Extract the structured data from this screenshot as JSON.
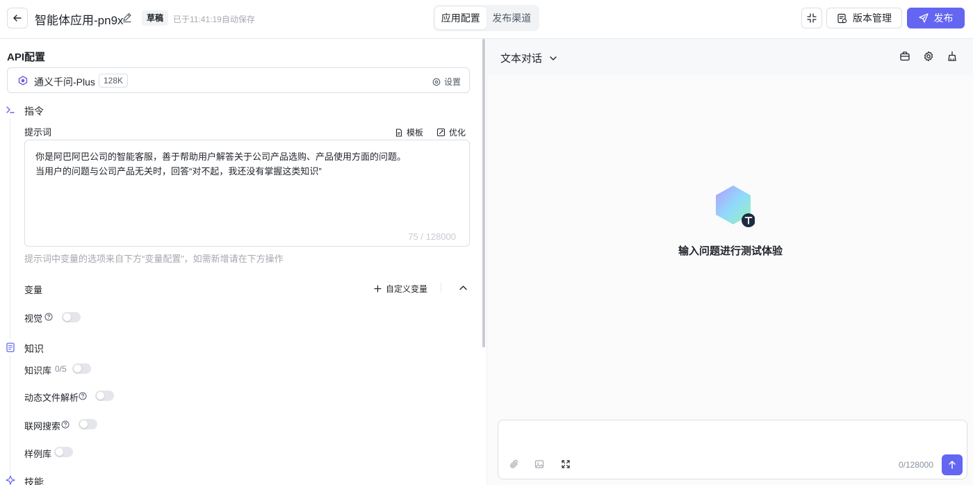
{
  "header": {
    "app_title": "智能体应用-pn9x",
    "status_badge": "草稿",
    "autosave_text": "已于11:41:19自动保存",
    "tabs": [
      {
        "label": "应用配置",
        "active": true
      },
      {
        "label": "发布渠道",
        "active": false
      }
    ],
    "version_label": "版本管理",
    "publish_label": "发布"
  },
  "left": {
    "api_title": "API配置",
    "model_name": "通义千问-Plus",
    "model_context": "128K",
    "model_settings_label": "设置",
    "instruction": {
      "title": "指令",
      "prompt_label": "提示词",
      "template_label": "模板",
      "optimize_label": "优化",
      "prompt_lines": [
        "你是阿巴阿巴公司的智能客服，善于帮助用户解答关于公司产品选购、产品使用方面的问题。",
        "当用户的问题与公司产品无关时，回答“对不起，我还没有掌握这类知识”"
      ],
      "char_count": "75 / 128000",
      "hint": "提示词中变量的选项来自下方“变量配置”，如需新增请在下方操作"
    },
    "variables": {
      "title": "变量",
      "custom_label": "自定义变量",
      "vision_label": "视觉",
      "vision_on": false
    },
    "knowledge": {
      "title": "知识",
      "kb_label": "知识库",
      "kb_count": "0/5",
      "kb_on": false,
      "dynamic_file_label": "动态文件解析",
      "dynamic_file_on": false,
      "web_search_label": "联网搜索",
      "web_search_on": false,
      "sample_label": "样例库",
      "sample_on": false
    },
    "skills_title": "技能"
  },
  "right": {
    "chat_mode": "文本对话",
    "empty_text": "输入问题进行测试体验",
    "input_count": "0/128000"
  },
  "colors": {
    "accent": "#6366f1",
    "border": "#dcdee3",
    "muted": "#a6a9b0"
  }
}
